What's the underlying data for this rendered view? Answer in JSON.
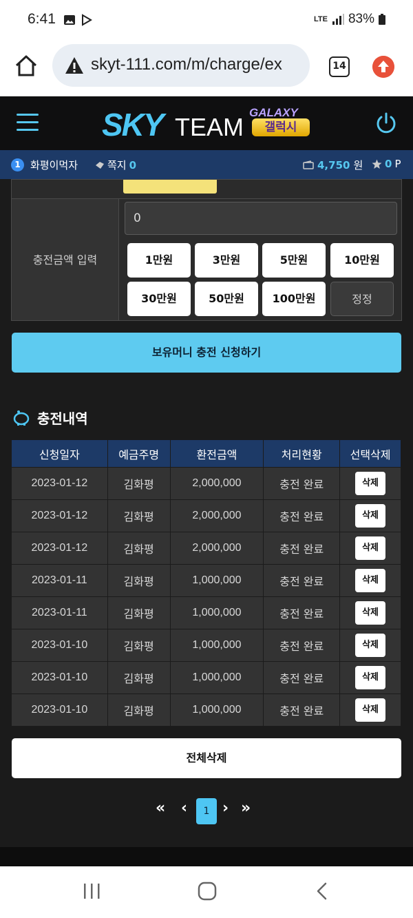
{
  "status_bar": {
    "time": "6:41",
    "network": "LTE",
    "battery": "83%"
  },
  "browser": {
    "url": "skyt-111.com/m/charge/ex",
    "tab_count": "14"
  },
  "site": {
    "logo_sky": "SKY",
    "logo_team": "TEAM",
    "logo_galaxy_en": "GALAXY",
    "logo_galaxy_kr": "갤럭시",
    "user": {
      "level": "1",
      "name": "화평이먹자",
      "message_label": "쪽지",
      "message_count": "0",
      "money": "4,750",
      "money_unit": "원",
      "point": "0",
      "point_unit": "P"
    },
    "form": {
      "amount_label": "충전금액 입력",
      "amount_value": "0",
      "amount_buttons": [
        "1만원",
        "3만원",
        "5만원",
        "10만원",
        "30만원",
        "50만원",
        "100만원"
      ],
      "reset_label": "정정"
    },
    "charge_button": "보유머니 충전 신청하기",
    "history_title": "충전내역",
    "table": {
      "headers": [
        "신청일자",
        "예금주명",
        "환전금액",
        "처리현황",
        "선택삭제"
      ],
      "delete_label": "삭제",
      "rows": [
        {
          "date": "2023-01-12",
          "name": "김화평",
          "amount": "2,000,000",
          "status": "충전 완료"
        },
        {
          "date": "2023-01-12",
          "name": "김화평",
          "amount": "2,000,000",
          "status": "충전 완료"
        },
        {
          "date": "2023-01-12",
          "name": "김화평",
          "amount": "2,000,000",
          "status": "충전 완료"
        },
        {
          "date": "2023-01-11",
          "name": "김화평",
          "amount": "1,000,000",
          "status": "충전 완료"
        },
        {
          "date": "2023-01-11",
          "name": "김화평",
          "amount": "1,000,000",
          "status": "충전 완료"
        },
        {
          "date": "2023-01-10",
          "name": "김화평",
          "amount": "1,000,000",
          "status": "충전 완료"
        },
        {
          "date": "2023-01-10",
          "name": "김화평",
          "amount": "1,000,000",
          "status": "충전 완료"
        },
        {
          "date": "2023-01-10",
          "name": "김화평",
          "amount": "1,000,000",
          "status": "충전 완료"
        }
      ]
    },
    "delete_all": "전체삭제",
    "pagination": {
      "first": "«",
      "prev": "‹",
      "current": "1",
      "next": "›",
      "last": "»"
    }
  },
  "colors": {
    "accent": "#4ec6f3",
    "header_blue": "#1d3a67",
    "background": "#1b1b1b"
  }
}
